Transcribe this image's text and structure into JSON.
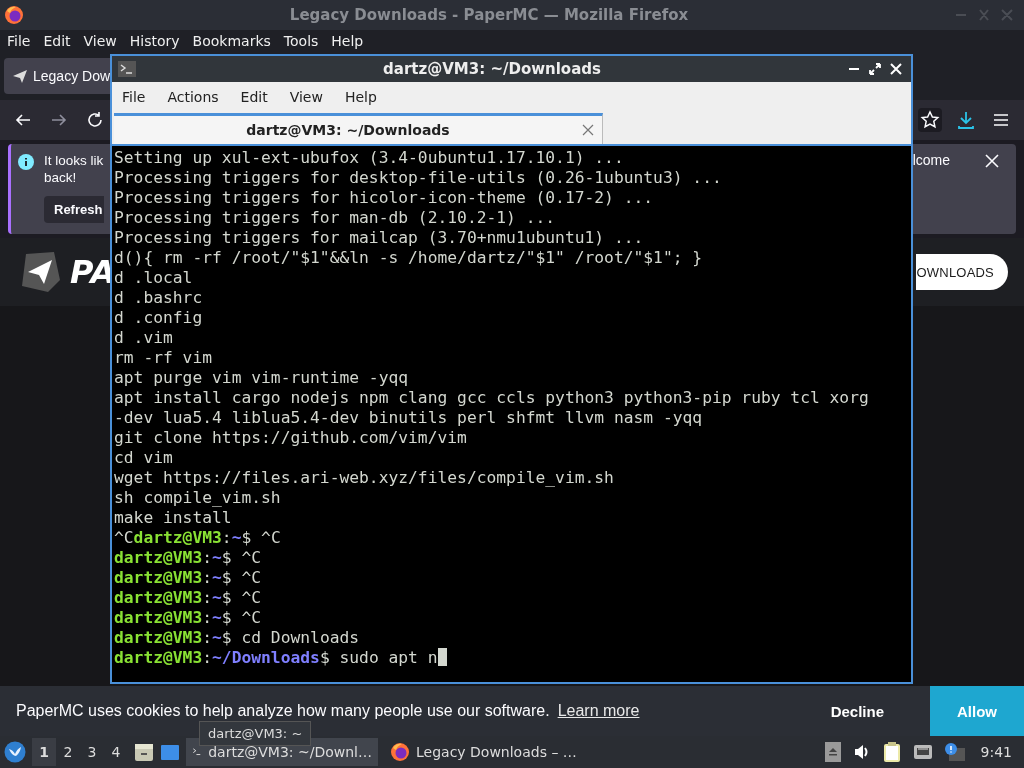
{
  "browser": {
    "title": "Legacy Downloads - PaperMC — Mozilla Firefox",
    "menu": [
      "File",
      "Edit",
      "View",
      "History",
      "Bookmarks",
      "Tools",
      "Help"
    ],
    "tabs": [
      {
        "label": "Legacy Dow",
        "selected": true
      }
    ],
    "notification": {
      "lines": [
        "It looks lik",
        "back!"
      ],
      "button": "Refresh",
      "tail": "lcome"
    },
    "site": {
      "logo_text": "PA",
      "button": "OWNLOADS"
    },
    "cookie_bar": {
      "text": "PaperMC uses cookies to help analyze how many people use our software.",
      "link": "Learn more",
      "decline": "Decline",
      "allow": "Allow"
    }
  },
  "terminal": {
    "title": "dartz@VM3: ~/Downloads",
    "menu": [
      "File",
      "Actions",
      "Edit",
      "View",
      "Help"
    ],
    "tabs": [
      {
        "label": "dartz@VM3: ~/Downloads",
        "selected": true
      }
    ],
    "lines": [
      {
        "segments": [
          {
            "kind": "plain",
            "text": "Setting up xul-ext-ubufox (3.4-0ubuntu1.17.10.1) ..."
          }
        ]
      },
      {
        "segments": [
          {
            "kind": "plain",
            "text": "Processing triggers for desktop-file-utils (0.26-1ubuntu3) ..."
          }
        ]
      },
      {
        "segments": [
          {
            "kind": "plain",
            "text": "Processing triggers for hicolor-icon-theme (0.17-2) ..."
          }
        ]
      },
      {
        "segments": [
          {
            "kind": "plain",
            "text": "Processing triggers for man-db (2.10.2-1) ..."
          }
        ]
      },
      {
        "segments": [
          {
            "kind": "plain",
            "text": "Processing triggers for mailcap (3.70+nmu1ubuntu1) ..."
          }
        ]
      },
      {
        "segments": [
          {
            "kind": "plain",
            "text": "d(){ rm -rf /root/\"$1\"&&ln -s /home/dartz/\"$1\" /root/\"$1\"; }"
          }
        ]
      },
      {
        "segments": [
          {
            "kind": "plain",
            "text": "d .local"
          }
        ]
      },
      {
        "segments": [
          {
            "kind": "plain",
            "text": "d .bashrc"
          }
        ]
      },
      {
        "segments": [
          {
            "kind": "plain",
            "text": "d .config"
          }
        ]
      },
      {
        "segments": [
          {
            "kind": "plain",
            "text": "d .vim"
          }
        ]
      },
      {
        "segments": [
          {
            "kind": "plain",
            "text": "rm -rf vim"
          }
        ]
      },
      {
        "segments": [
          {
            "kind": "plain",
            "text": "apt purge vim vim-runtime -yqq"
          }
        ]
      },
      {
        "segments": [
          {
            "kind": "plain",
            "text": "apt install cargo nodejs npm clang gcc ccls python3 python3-pip ruby tcl xorg"
          }
        ]
      },
      {
        "segments": [
          {
            "kind": "plain",
            "text": "-dev lua5.4 liblua5.4-dev binutils perl shfmt llvm nasm -yqq"
          }
        ]
      },
      {
        "segments": [
          {
            "kind": "plain",
            "text": "git clone https://github.com/vim/vim"
          }
        ]
      },
      {
        "segments": [
          {
            "kind": "plain",
            "text": "cd vim"
          }
        ]
      },
      {
        "segments": [
          {
            "kind": "plain",
            "text": "wget https://files.ari-web.xyz/files/compile_vim.sh"
          }
        ]
      },
      {
        "segments": [
          {
            "kind": "plain",
            "text": "sh compile_vim.sh"
          }
        ]
      },
      {
        "segments": [
          {
            "kind": "plain",
            "text": "make install"
          }
        ]
      },
      {
        "segments": [
          {
            "kind": "plain",
            "text": "^C"
          },
          {
            "kind": "user",
            "text": "dartz@VM3"
          },
          {
            "kind": "plain",
            "text": ":"
          },
          {
            "kind": "path",
            "text": "~"
          },
          {
            "kind": "plain",
            "text": "$ ^C"
          }
        ]
      },
      {
        "segments": [
          {
            "kind": "user",
            "text": "dartz@VM3"
          },
          {
            "kind": "plain",
            "text": ":"
          },
          {
            "kind": "path",
            "text": "~"
          },
          {
            "kind": "plain",
            "text": "$ ^C"
          }
        ]
      },
      {
        "segments": [
          {
            "kind": "user",
            "text": "dartz@VM3"
          },
          {
            "kind": "plain",
            "text": ":"
          },
          {
            "kind": "path",
            "text": "~"
          },
          {
            "kind": "plain",
            "text": "$ ^C"
          }
        ]
      },
      {
        "segments": [
          {
            "kind": "user",
            "text": "dartz@VM3"
          },
          {
            "kind": "plain",
            "text": ":"
          },
          {
            "kind": "path",
            "text": "~"
          },
          {
            "kind": "plain",
            "text": "$ ^C"
          }
        ]
      },
      {
        "segments": [
          {
            "kind": "user",
            "text": "dartz@VM3"
          },
          {
            "kind": "plain",
            "text": ":"
          },
          {
            "kind": "path",
            "text": "~"
          },
          {
            "kind": "plain",
            "text": "$ ^C"
          }
        ]
      },
      {
        "segments": [
          {
            "kind": "user",
            "text": "dartz@VM3"
          },
          {
            "kind": "plain",
            "text": ":"
          },
          {
            "kind": "path",
            "text": "~"
          },
          {
            "kind": "plain",
            "text": "$ cd Downloads"
          }
        ]
      },
      {
        "segments": [
          {
            "kind": "user",
            "text": "dartz@VM3"
          },
          {
            "kind": "plain",
            "text": ":"
          },
          {
            "kind": "path",
            "text": "~/Downloads"
          },
          {
            "kind": "plain",
            "text": "$ sudo apt n"
          }
        ],
        "cursor": true
      }
    ]
  },
  "taskbar": {
    "workspaces": [
      {
        "label": "1",
        "selected": true
      },
      {
        "label": "2",
        "selected": false
      },
      {
        "label": "3",
        "selected": false
      },
      {
        "label": "4",
        "selected": false
      }
    ],
    "tasks": [
      {
        "kind": "terminal",
        "label": "dartz@VM3: ~/Downl…",
        "selected": true
      },
      {
        "kind": "firefox",
        "label": "Legacy Downloads – …",
        "selected": false
      }
    ],
    "tooltip": "dartz@VM3: ~",
    "clock": "9:41"
  }
}
